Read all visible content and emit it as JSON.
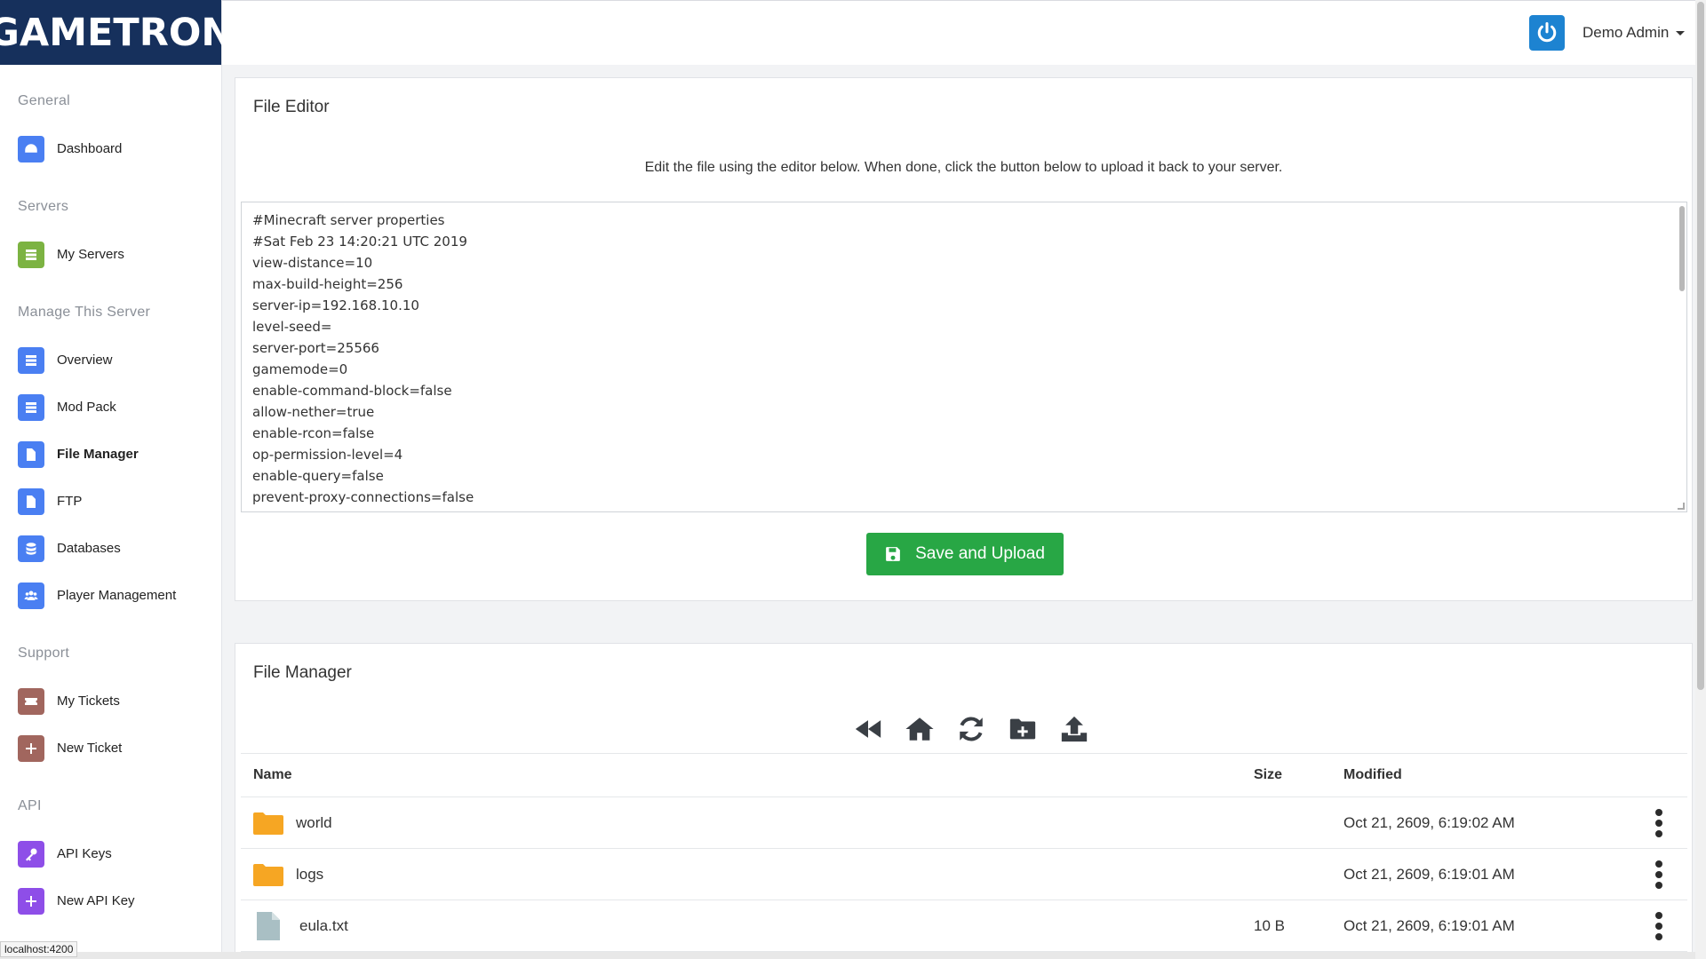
{
  "brand": {
    "name": "GAMETRON",
    "color": "#16305c"
  },
  "user": {
    "name": "Demo Admin"
  },
  "sidebar": {
    "sections": [
      {
        "title": "General",
        "items": [
          {
            "label": "Dashboard",
            "icon": "dashboard-icon",
            "color": "#4a7ff2"
          }
        ]
      },
      {
        "title": "Servers",
        "items": [
          {
            "label": "My Servers",
            "icon": "servers-icon",
            "color": "#7cb342"
          }
        ]
      },
      {
        "title": "Manage This Server",
        "items": [
          {
            "label": "Overview",
            "icon": "list-icon",
            "color": "#4a7ff2"
          },
          {
            "label": "Mod Pack",
            "icon": "list-icon",
            "color": "#4a7ff2"
          },
          {
            "label": "File Manager",
            "icon": "file-icon",
            "color": "#4a7ff2"
          },
          {
            "label": "FTP",
            "icon": "file-icon",
            "color": "#4a7ff2"
          },
          {
            "label": "Databases",
            "icon": "database-icon",
            "color": "#4a7ff2"
          },
          {
            "label": "Player Management",
            "icon": "users-icon",
            "color": "#4a7ff2"
          }
        ]
      },
      {
        "title": "Support",
        "items": [
          {
            "label": "My Tickets",
            "icon": "ticket-icon",
            "color": "#a1665e"
          },
          {
            "label": "New Ticket",
            "icon": "plus-icon",
            "color": "#a1665e"
          }
        ]
      },
      {
        "title": "API",
        "items": [
          {
            "label": "API Keys",
            "icon": "key-icon",
            "color": "#8e4ee8"
          },
          {
            "label": "New API Key",
            "icon": "plus-icon",
            "color": "#8e4ee8"
          }
        ]
      }
    ],
    "active_item": "File Manager"
  },
  "editor": {
    "title": "File Editor",
    "description": "Edit the file using the editor below. When done, click the button below to upload it back to your server.",
    "lines": [
      "#Minecraft server properties",
      "#Sat Feb 23 14:20:21 UTC 2019",
      "view-distance=10",
      "max-build-height=256",
      "server-ip=192.168.10.10",
      "level-seed=",
      "server-port=25566",
      "gamemode=0",
      "enable-command-block=false",
      "allow-nether=true",
      "enable-rcon=false",
      "op-permission-level=4",
      "enable-query=false",
      "prevent-proxy-connections=false"
    ],
    "save_label": "Save and Upload",
    "save_color": "#28a745"
  },
  "file_manager": {
    "title": "File Manager",
    "toolbar": [
      "back-icon",
      "home-icon",
      "refresh-icon",
      "new-folder-icon",
      "upload-icon"
    ],
    "columns": {
      "name": "Name",
      "size": "Size",
      "modified": "Modified"
    },
    "rows": [
      {
        "type": "folder",
        "name": "world",
        "size": "",
        "modified": "Oct 21, 2609, 6:19:02 AM"
      },
      {
        "type": "folder",
        "name": "logs",
        "size": "",
        "modified": "Oct 21, 2609, 6:19:01 AM"
      },
      {
        "type": "file",
        "name": "eula.txt",
        "size": "10 B",
        "modified": "Oct 21, 2609, 6:19:01 AM"
      }
    ]
  },
  "status_url": "localhost:4200"
}
